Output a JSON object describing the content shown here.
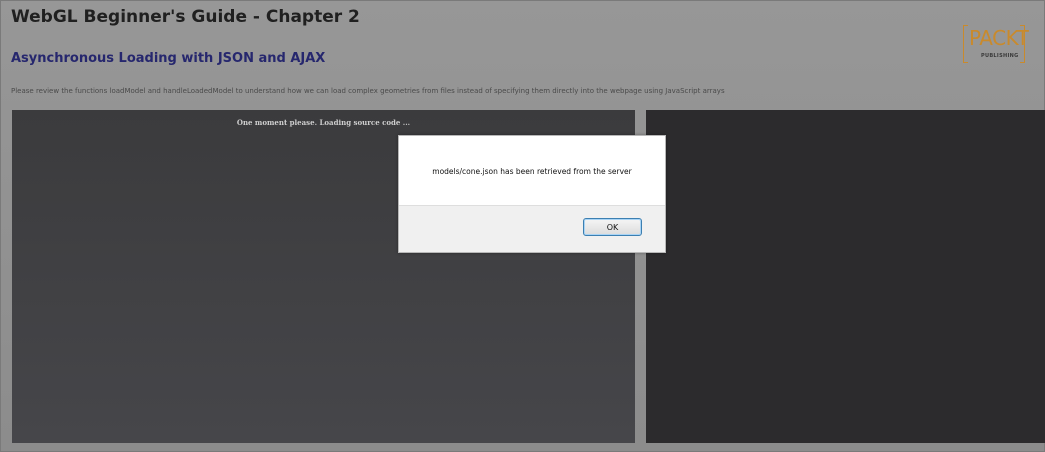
{
  "header": {
    "title": "WebGL Beginner's Guide - Chapter 2",
    "subtitle": "Asynchronous Loading with JSON and AJAX",
    "description": "Please review the functions loadModel and handleLoadedModel to understand how we can load complex geometries from files instead of specifying them directly into the webpage using JavaScript arrays"
  },
  "logo": {
    "wordmark": "PACKT",
    "subtext": "PUBLISHING"
  },
  "source_panel": {
    "loading_text": "One moment please. Loading source code ..."
  },
  "alert": {
    "message": "models/cone.json has been retrieved from the server",
    "ok_label": "OK"
  },
  "colors": {
    "title": "#202020",
    "subtitle": "#26276e",
    "logo_accent": "#c98a2c",
    "page_bg": "#8f8f8f",
    "panel_dark": "#2c2b2d"
  }
}
